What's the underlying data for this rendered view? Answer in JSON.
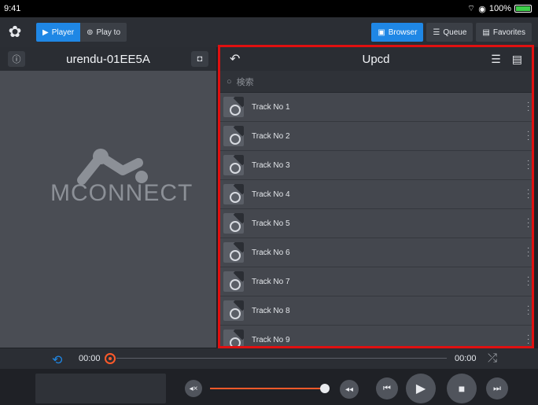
{
  "status": {
    "time": "9:41",
    "battery": "100%"
  },
  "topbar": {
    "settings_icon": "gear-icon",
    "player_label": "Player",
    "playto_label": "Play to",
    "browser_label": "Browser",
    "queue_label": "Queue",
    "favorites_label": "Favorites"
  },
  "left": {
    "device_name": "urendu-01EE5A",
    "logo_text": "MCONNECT"
  },
  "browser": {
    "title": "Upcd",
    "search_placeholder": "検索",
    "tracks": [
      {
        "name": "Track No 1"
      },
      {
        "name": "Track No 2"
      },
      {
        "name": "Track No 3"
      },
      {
        "name": "Track No 4"
      },
      {
        "name": "Track No 5"
      },
      {
        "name": "Track No 6"
      },
      {
        "name": "Track No 7"
      },
      {
        "name": "Track No 8"
      },
      {
        "name": "Track No 9"
      }
    ]
  },
  "playback": {
    "elapsed": "00:00",
    "duration": "00:00",
    "volume_level": 0.95
  },
  "colors": {
    "accent": "#1f87e5",
    "highlight_border": "#e01010",
    "progress": "#ff5a2a"
  }
}
